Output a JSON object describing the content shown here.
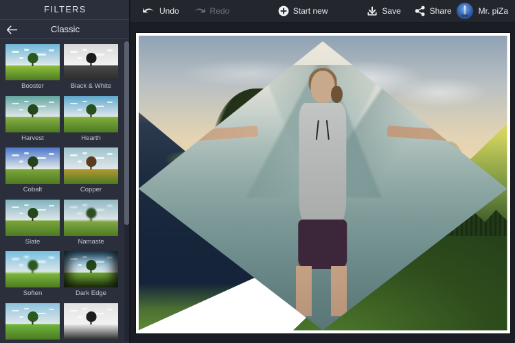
{
  "app": {
    "accent_dark": "#2b2f3c",
    "toolbar_bg": "#24262e",
    "canvas_bg": "#1b1d24",
    "text_color": "#e8eaef",
    "disabled_color": "#6d707b"
  },
  "sidebar": {
    "title": "FILTERS",
    "category": "Classic",
    "back_icon": "arrow-left-icon",
    "filters": [
      {
        "label": "Booster",
        "sky": "#6fb7d8",
        "ground": "#8fc23a",
        "crown": "#2c5a1e",
        "trunk": "#3b2a18",
        "style": "normal"
      },
      {
        "label": "Black & White",
        "sky": "#d8d8d8",
        "ground": "#4a4a4a",
        "crown": "#1a1a1a",
        "trunk": "#111111",
        "style": "mono"
      },
      {
        "label": "Harvest",
        "sky": "#63a6a0",
        "ground": "#8ab348",
        "crown": "#24471b",
        "trunk": "#33281a",
        "style": "warm"
      },
      {
        "label": "Hearth",
        "sky": "#5fa8cd",
        "ground": "#7fb03d",
        "crown": "#27511c",
        "trunk": "#35261a",
        "style": "normal"
      },
      {
        "label": "Cobalt",
        "sky": "#4c76c9",
        "ground": "#7fa83c",
        "crown": "#23441a",
        "trunk": "#2e2216",
        "style": "cool"
      },
      {
        "label": "Copper",
        "sky": "#9fc2cc",
        "ground": "#b59a33",
        "crown": "#5a3a1c",
        "trunk": "#3a2514",
        "style": "copper"
      },
      {
        "label": "Slate",
        "sky": "#7fb2bd",
        "ground": "#7aa83c",
        "crown": "#25481b",
        "trunk": "#2f2316",
        "style": "slate"
      },
      {
        "label": "Namaste",
        "sky": "#8fb9c4",
        "ground": "#86ac49",
        "crown": "#2c4f20",
        "trunk": "#332616",
        "style": "soft"
      },
      {
        "label": "Soften",
        "sky": "#75bfe0",
        "ground": "#7fbc3d",
        "crown": "#2a5a1d",
        "trunk": "#332616",
        "style": "soft"
      },
      {
        "label": "Dark Edge",
        "sky": "#5aa8d4",
        "ground": "#6fa837",
        "crown": "#24491a",
        "trunk": "#2c2115",
        "style": "vignette"
      },
      {
        "label": "",
        "sky": "#8ec4dd",
        "ground": "#6fb83c",
        "crown": "#2a5a1e",
        "trunk": "#332616",
        "style": "normal"
      },
      {
        "label": "",
        "sky": "#e2e2e2",
        "ground": "#f0f0f0",
        "crown": "#1c1c1c",
        "trunk": "#121212",
        "style": "mono"
      }
    ],
    "scrollbar": {
      "name": "filter-list-scrollbar"
    }
  },
  "toolbar": {
    "undo": {
      "label": "Undo",
      "icon": "undo-arrow-icon",
      "enabled": true
    },
    "redo": {
      "label": "Redo",
      "icon": "redo-arrow-icon",
      "enabled": false
    },
    "start_new": {
      "label": "Start new",
      "icon": "plus-circle-icon"
    },
    "save": {
      "label": "Save",
      "icon": "download-icon"
    },
    "share": {
      "label": "Share",
      "icon": "share-nodes-icon"
    },
    "user": {
      "name": "Mr. piZa",
      "avatar_icon": "user-avatar"
    }
  },
  "canvas": {
    "layout": "five-piece-diamond-collage",
    "border_color": "#ffffff",
    "photos": [
      {
        "slot": "top-left",
        "description": "sunset trees in misty meadow"
      },
      {
        "slot": "top-right",
        "description": "lavender field at purple sunset"
      },
      {
        "slot": "center",
        "description": "woman with outstretched arms before misty mountains"
      },
      {
        "slot": "bottom-left",
        "description": "dark blue sand dunes with green moss"
      },
      {
        "slot": "bottom-right",
        "description": "golden sunset over forested mountains"
      }
    ]
  }
}
